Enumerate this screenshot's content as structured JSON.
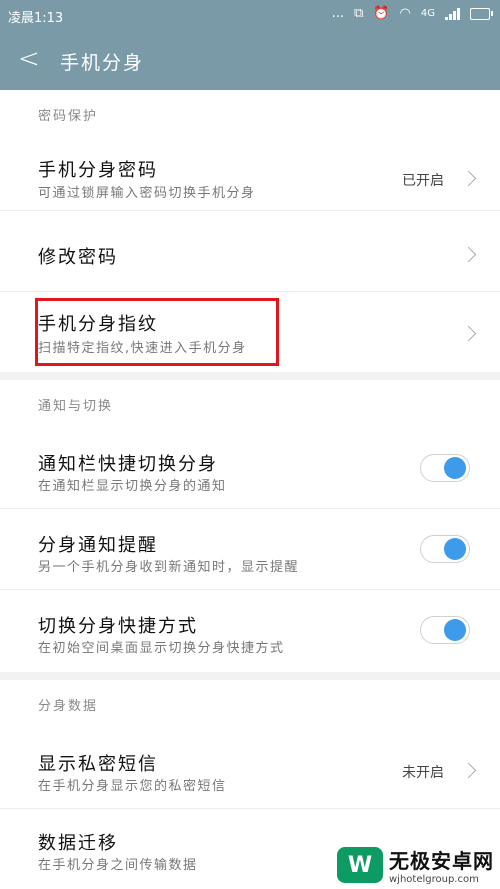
{
  "status_bar": {
    "time": "凌晨1:13",
    "dots": "...",
    "network": "4G"
  },
  "app_bar": {
    "title": "手机分身"
  },
  "sections": {
    "password": "密码保护",
    "notify": "通知与切换",
    "data": "分身数据"
  },
  "rows": {
    "pwd": {
      "title": "手机分身密码",
      "sub": "可通过锁屏输入密码切换手机分身",
      "value": "已开启"
    },
    "change_pwd": {
      "title": "修改密码"
    },
    "fingerprint": {
      "title": "手机分身指纹",
      "sub": "扫描特定指纹,快速进入手机分身"
    },
    "notify_switch": {
      "title": "通知栏快捷切换分身",
      "sub": "在通知栏显示切换分身的通知",
      "on": true
    },
    "notify_remind": {
      "title": "分身通知提醒",
      "sub": "另一个手机分身收到新通知时，显示提醒",
      "on": true
    },
    "shortcut": {
      "title": "切换分身快捷方式",
      "sub": "在初始空间桌面显示切换分身快捷方式",
      "on": true
    },
    "private_sms": {
      "title": "显示私密短信",
      "sub": "在手机分身显示您的私密短信",
      "value": "未开启"
    },
    "migrate": {
      "title": "数据迁移",
      "sub": "在手机分身之间传输数据"
    }
  },
  "watermark": {
    "logo": "W",
    "name": "无极安卓网",
    "url": "wjhotelgroup.com"
  },
  "colors": {
    "header": "#7b9aa8",
    "toggle_on": "#3d9be9",
    "highlight": "#e0161b"
  }
}
